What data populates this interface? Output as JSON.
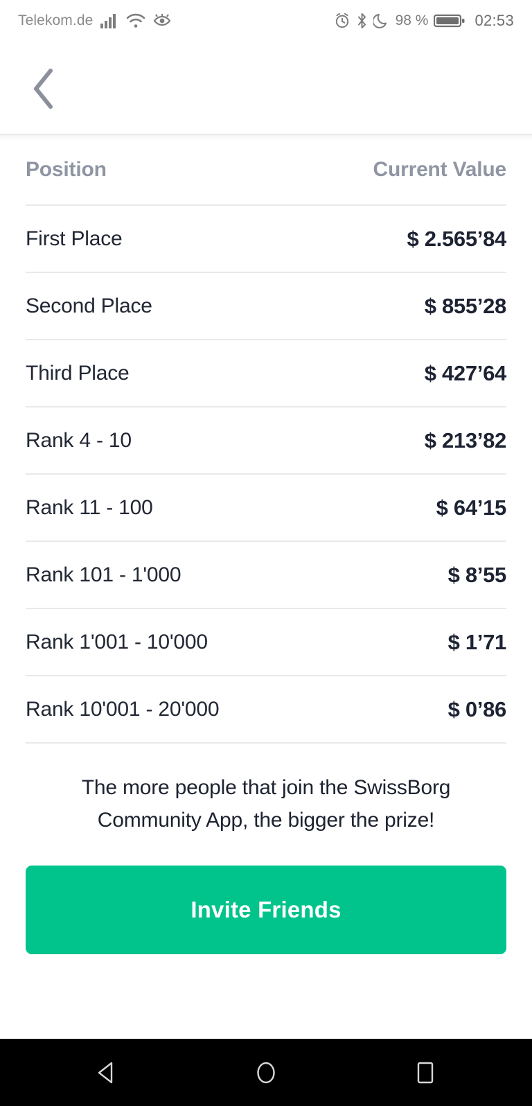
{
  "status_bar": {
    "carrier": "Telekom.de",
    "battery_percent": "98 %",
    "clock": "02:53",
    "icons": [
      "signal-bars-icon",
      "wifi-icon",
      "eye-comfort-icon",
      "alarm-icon",
      "bluetooth-icon",
      "do-not-disturb-moon-icon",
      "battery-icon"
    ]
  },
  "app_bar": {
    "back_icon": "chevron-left-icon"
  },
  "table": {
    "headers": {
      "position": "Position",
      "current_value": "Current Value"
    },
    "rows": [
      {
        "position": "First Place",
        "value": "$ 2.565’84"
      },
      {
        "position": "Second Place",
        "value": "$ 855’28"
      },
      {
        "position": "Third Place",
        "value": "$ 427’64"
      },
      {
        "position": "Rank 4 - 10",
        "value": "$ 213’82"
      },
      {
        "position": "Rank 11 - 100",
        "value": "$ 64’15"
      },
      {
        "position": "Rank 101 - 1'000",
        "value": "$ 8’55"
      },
      {
        "position": "Rank 1'001 - 10'000",
        "value": "$ 1’71"
      },
      {
        "position": "Rank 10'001 - 20'000",
        "value": "$ 0’86"
      }
    ]
  },
  "promo": {
    "text": "The more people that join the SwissBorg Community App, the bigger the prize!"
  },
  "cta": {
    "label": "Invite Friends"
  },
  "nav_bar": {
    "back": "nav-back-icon",
    "home": "nav-home-icon",
    "recents": "nav-recents-icon"
  },
  "colors": {
    "accent_green": "#01c38c",
    "header_grey": "#8f95a3",
    "text_dark": "#1e2333",
    "divider": "#e8e9eb"
  }
}
